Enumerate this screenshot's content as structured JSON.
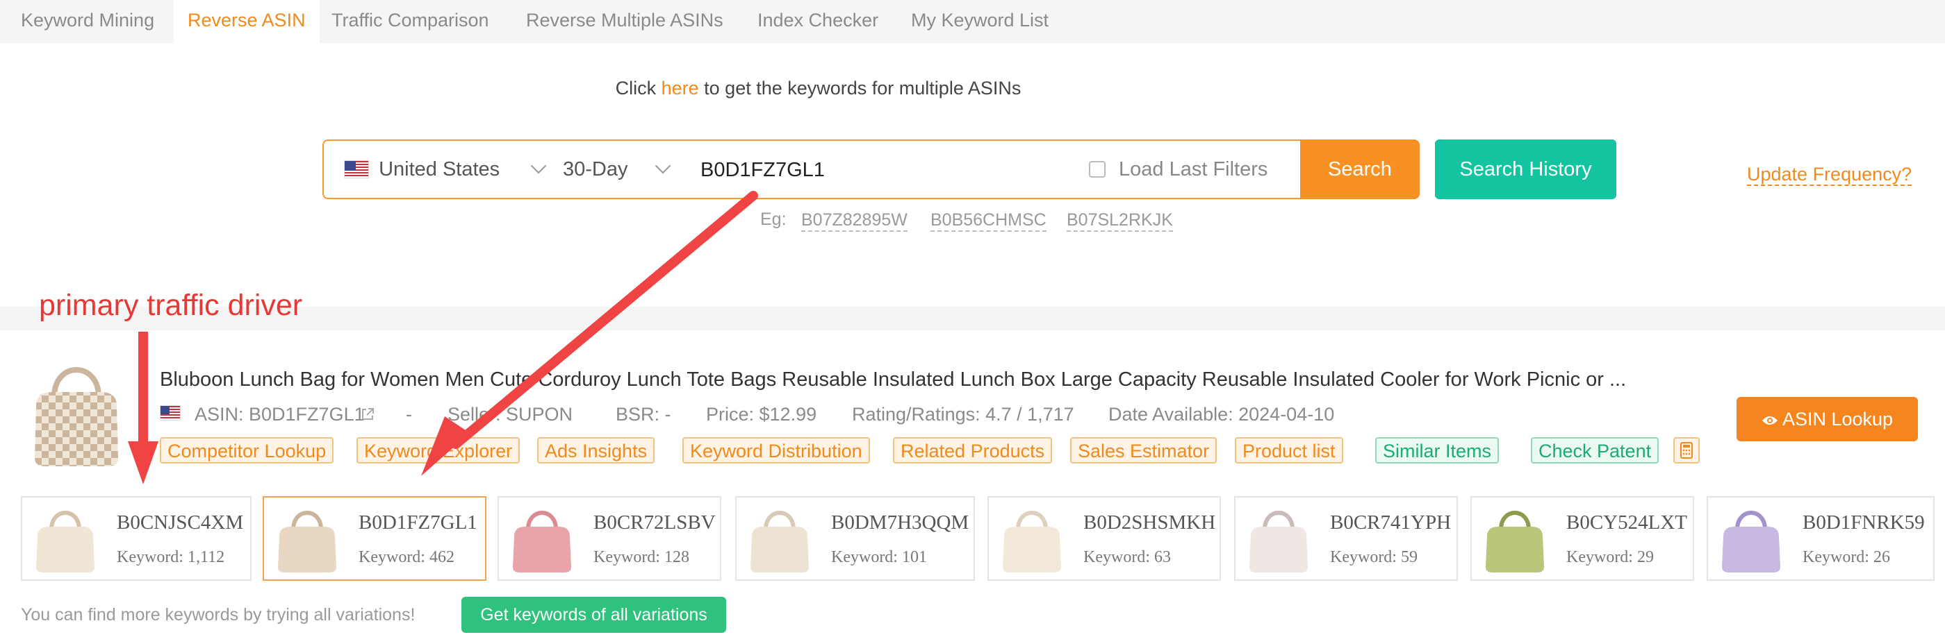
{
  "tabs": [
    {
      "label": "Keyword Mining"
    },
    {
      "label": "Reverse ASIN"
    },
    {
      "label": "Traffic Comparison"
    },
    {
      "label": "Reverse Multiple ASINs"
    },
    {
      "label": "Index Checker"
    },
    {
      "label": "My Keyword List"
    }
  ],
  "hint": {
    "before": "Click ",
    "link": "here",
    "after": " to get the keywords for multiple ASINs"
  },
  "search": {
    "country": "United States",
    "period": "30-Day",
    "asin_value": "B0D1FZ7GL1",
    "load_last_filters": "Load Last Filters",
    "search_label": "Search",
    "history_label": "Search History",
    "update_frequency": "Update Frequency?"
  },
  "examples": {
    "label": "Eg:",
    "items": [
      "B07Z82895W",
      "B0B56CHMSC",
      "B07SL2RKJK"
    ]
  },
  "annotation": "primary traffic driver",
  "product": {
    "title": "Bluboon Lunch Bag for Women Men Cute Corduroy Lunch Tote Bags Reusable Insulated Lunch Box Large Capacity Reusable Insulated Cooler for Work Picnic or ...",
    "asin": "ASIN: B0D1FZ7GL1",
    "dash": "-",
    "seller": "Seller: SUPON",
    "bsr": "BSR: -",
    "price": "Price: $12.99",
    "rating": "Rating/Ratings: 4.7 / 1,717",
    "date": "Date Available: 2024-04-10",
    "tags": [
      "Competitor Lookup",
      "Keyword Explorer",
      "Ads Insights",
      "Keyword Distribution",
      "Related Products",
      "Sales Estimator",
      "Product list",
      "Similar Items",
      "Check Patent"
    ],
    "lookup_label": "ASIN Lookup"
  },
  "variations": [
    {
      "asin": "B0CNJSC4XM",
      "keyword": "Keyword: 1,112",
      "color": "#f1e6d6"
    },
    {
      "asin": "B0D1FZ7GL1",
      "keyword": "Keyword: 462",
      "color": "#e7d7c3"
    },
    {
      "asin": "B0CR72LSBV",
      "keyword": "Keyword: 128",
      "color": "#e9a4aa"
    },
    {
      "asin": "B0DM7H3QQM",
      "keyword": "Keyword: 101",
      "color": "#ede3d3"
    },
    {
      "asin": "B0D2SHSMKH",
      "keyword": "Keyword: 63",
      "color": "#f3e9db"
    },
    {
      "asin": "B0CR741YPH",
      "keyword": "Keyword: 59",
      "color": "#efe7e4"
    },
    {
      "asin": "B0CY524LXT",
      "keyword": "Keyword: 29",
      "color": "#b9c77a"
    },
    {
      "asin": "B0D1FNRK59",
      "keyword": "Keyword: 26",
      "color": "#c8b9e3"
    }
  ],
  "footer": {
    "more_text": "You can find more keywords by trying all variations!",
    "all_variations_label": "Get keywords of all variations"
  },
  "colors": {
    "accent": "#f79123",
    "teal": "#12c5a0",
    "green": "#2ec27e",
    "annotation": "#e53935"
  }
}
